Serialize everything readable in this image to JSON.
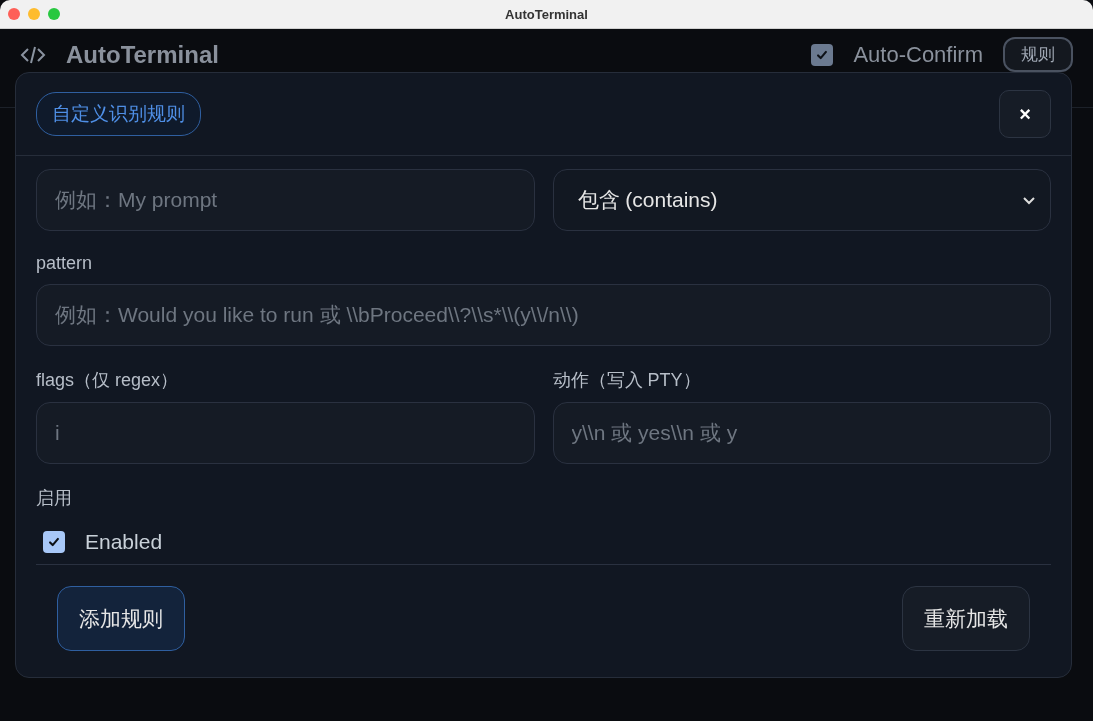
{
  "window": {
    "title": "AutoTerminal"
  },
  "app_header": {
    "title": "AutoTerminal",
    "auto_confirm": {
      "label": "Auto-Confirm",
      "checked": true
    },
    "rules_button": "规则"
  },
  "dialog": {
    "title": "自定义识别规则",
    "close": "×",
    "name_field": {
      "placeholder": "例如：My prompt"
    },
    "match_select": {
      "value": "包含 (contains)"
    },
    "pattern": {
      "label": "pattern",
      "placeholder": "例如：Would you like to run 或 \\\\bProceed\\\\?\\\\s*\\\\(y\\\\/n\\\\)"
    },
    "flags": {
      "label": "flags（仅 regex）",
      "placeholder": "i"
    },
    "action": {
      "label": "动作（写入 PTY）",
      "placeholder": "y\\\\n 或 yes\\\\n 或 y"
    },
    "enabled": {
      "label": "启用",
      "checkbox_label": "Enabled",
      "checked": true
    },
    "buttons": [
      {
        "label": "添加规则",
        "kind": "primary"
      },
      {
        "label": "重新加载",
        "kind": "secondary"
      }
    ]
  }
}
